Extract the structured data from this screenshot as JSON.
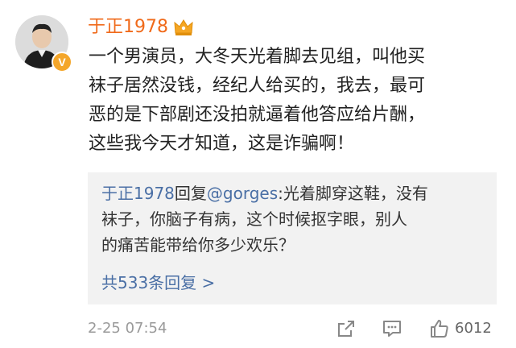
{
  "post": {
    "username": "于正1978",
    "verified_badge": "V",
    "lines": [
      "一个男演员，大冬天光着脚去见组，叫他买",
      "袜子居然没钱，经纪人给买的，我去，最可",
      "恶的是下部剧还没拍就逼着他答应给片酬，",
      "这些我今天才知道，这是诈骗啊！"
    ],
    "timestamp": "2-25 07:54",
    "like_count": "6012"
  },
  "reply": {
    "author": "于正1978",
    "action_word": "回复",
    "target": "@gorges",
    "line1_rest": ":光着脚穿这鞋，没有",
    "line2": "袜子，你脑子有病，这个时候抠字眼，别人",
    "line3": "的痛苦能带给你多少欢乐？",
    "more_replies": "共533条回复 >"
  },
  "colors": {
    "username": "#f06a1a",
    "link": "#4a6fa5",
    "reply_bg": "#f2f2f2",
    "timestamp": "#9a9a9a",
    "icon": "#888888",
    "crown": "#f5a623",
    "badge": "#f4a62a"
  },
  "icons": [
    "crown-icon",
    "share-icon",
    "comment-icon",
    "like-icon"
  ]
}
